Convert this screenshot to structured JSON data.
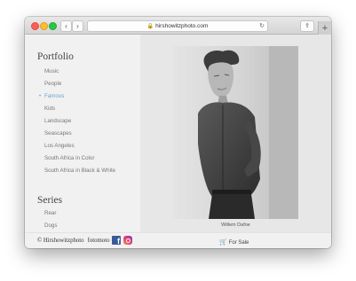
{
  "browser": {
    "url": "hirshowitzphoto.com",
    "back_glyph": "‹",
    "forward_glyph": "›",
    "reload_glyph": "↻",
    "share_glyph": "⇪",
    "new_tab_glyph": "+",
    "lock_glyph": "🔒"
  },
  "sidebar": {
    "portfolio_heading": "Portfolio",
    "portfolio_items": [
      {
        "label": "Music",
        "active": false
      },
      {
        "label": "People",
        "active": false
      },
      {
        "label": "Famous",
        "active": true
      },
      {
        "label": "Kids",
        "active": false
      },
      {
        "label": "Landscape",
        "active": false
      },
      {
        "label": "Seascapes",
        "active": false
      },
      {
        "label": "Los Angeles",
        "active": false
      },
      {
        "label": "South Africa in Color",
        "active": false
      },
      {
        "label": "South Africa in Black & White",
        "active": false
      }
    ],
    "series_heading": "Series",
    "series_items": [
      {
        "label": "Rear"
      },
      {
        "label": "Dogs"
      }
    ],
    "active_color": "#6d9fcc"
  },
  "main": {
    "photo_caption": "Willem Dafoe"
  },
  "footer": {
    "copyright": "© Hirshowitzphoto",
    "fotomoto": "fotomoto",
    "facebook_glyph": "f",
    "for_sale": "For Sale",
    "cart_glyph": "🛒"
  }
}
